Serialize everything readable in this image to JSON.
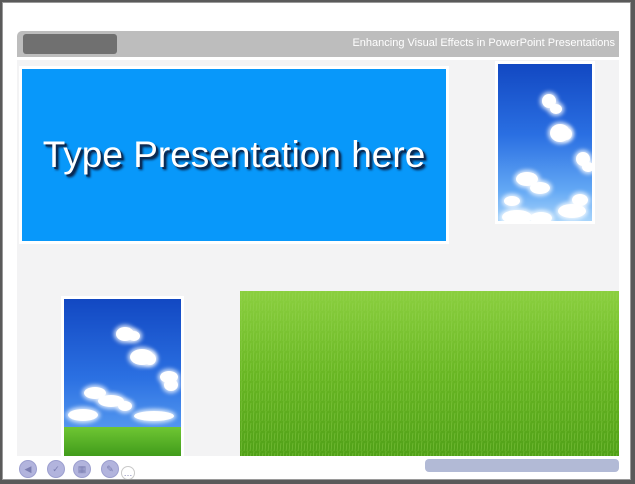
{
  "slide": {
    "header_title": "Enhancing Visual Effects in PowerPoint Presentations",
    "title_text": "Type Presentation here"
  },
  "colors": {
    "title_box": "#0898fa",
    "header_bar": "#bdbdbd",
    "header_tab": "#707070",
    "progress_pill": "#b2bad6",
    "nav_dot": "#b2b4dd"
  },
  "images": [
    "sky-clouds-photo",
    "sky-clouds-grass-photo",
    "grass-field-photo"
  ],
  "nav": {
    "buttons": [
      {
        "name": "previous-slide-icon",
        "glyph": "◀"
      },
      {
        "name": "next-slide-icon",
        "glyph": "✓"
      },
      {
        "name": "slides-grid-icon",
        "glyph": "▦"
      },
      {
        "name": "pen-tool-icon",
        "glyph": "✎"
      },
      {
        "name": "menu-icon",
        "glyph": "…"
      }
    ]
  }
}
